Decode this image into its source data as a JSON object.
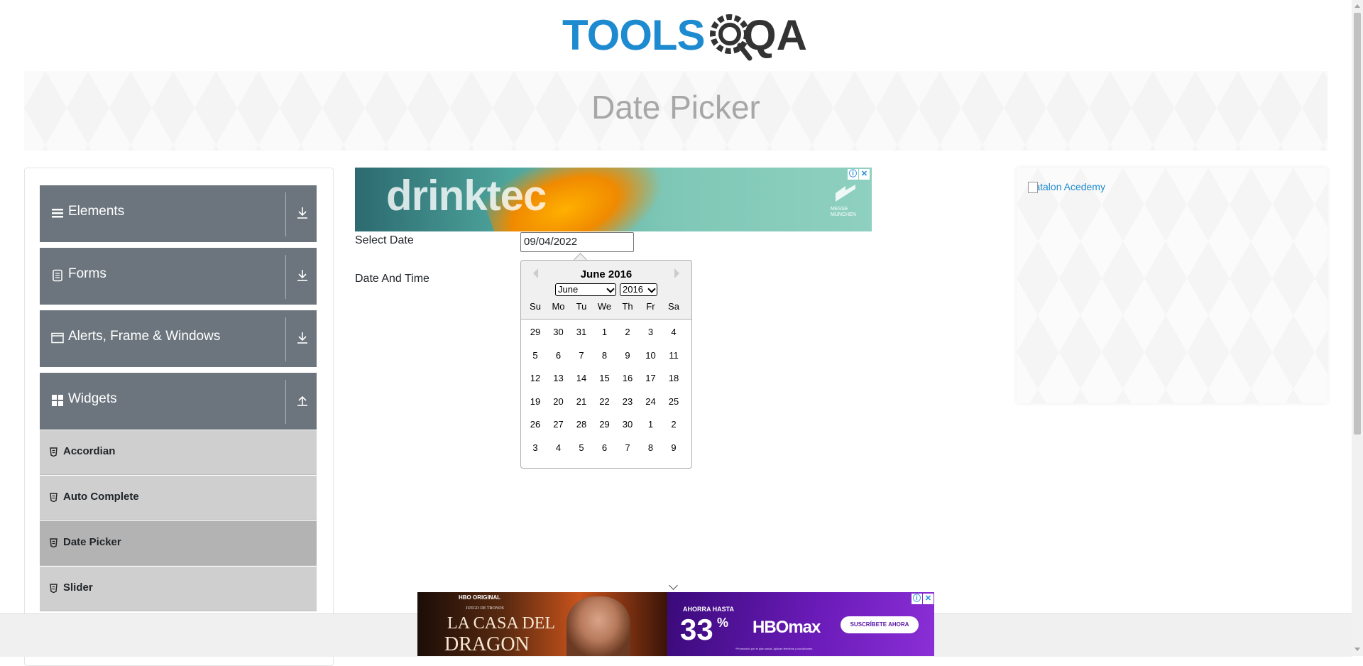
{
  "header": {
    "logo_part1": "TOOLS",
    "logo_part2": "QA"
  },
  "banner": {
    "title": "Date Picker"
  },
  "sidebar": {
    "groups": [
      {
        "label": "Elements",
        "icon": "hamburger-icon"
      },
      {
        "label": "Forms",
        "icon": "document-icon"
      },
      {
        "label": "Alerts, Frame & Windows",
        "icon": "window-icon"
      },
      {
        "label": "Widgets",
        "icon": "widgets-grid-icon"
      }
    ],
    "items": [
      {
        "label": "Accordian"
      },
      {
        "label": "Auto Complete"
      },
      {
        "label": "Date Picker"
      },
      {
        "label": "Slider"
      }
    ]
  },
  "ad_top": {
    "brand": "drinktec",
    "sponsor": "MESSE MÜNCHEN",
    "close_label": "✕",
    "info_label": "ⓘ"
  },
  "form": {
    "select_date_label": "Select Date",
    "select_date_value": "09/04/2022",
    "date_time_label": "Date And Time"
  },
  "calendar": {
    "title": "June 2016",
    "month_selected": "June",
    "year_selected": "2016",
    "weekdays": [
      "Su",
      "Mo",
      "Tu",
      "We",
      "Th",
      "Fr",
      "Sa"
    ],
    "weeks": [
      [
        "29",
        "30",
        "31",
        "1",
        "2",
        "3",
        "4"
      ],
      [
        "5",
        "6",
        "7",
        "8",
        "9",
        "10",
        "11"
      ],
      [
        "12",
        "13",
        "14",
        "15",
        "16",
        "17",
        "18"
      ],
      [
        "19",
        "20",
        "21",
        "22",
        "23",
        "24",
        "25"
      ],
      [
        "26",
        "27",
        "28",
        "29",
        "30",
        "1",
        "2"
      ],
      [
        "3",
        "4",
        "5",
        "6",
        "7",
        "8",
        "9"
      ]
    ]
  },
  "ad_right": {
    "alt_text": "Katalon Acedemy"
  },
  "ad_bottom": {
    "hbo_original": "HBO ORIGINAL",
    "series_sub": "JUEGO DE TRONOS",
    "title_line1": "LA CASA DEL",
    "title_line2": "DRAGON",
    "ahorra": "AHORRA HASTA",
    "discount": "33",
    "percent": "%",
    "brand": "HBOmax",
    "cta": "SUSCRÍBETE AHORA",
    "fine_print": "*Promoción por el plan anual. Aplican términos y condiciones."
  },
  "colors": {
    "accent": "#1e8bd0",
    "sidebar_group": "#6c757d",
    "sidebar_item": "#cfcfcf",
    "sidebar_item_active": "#b3b3b3"
  }
}
